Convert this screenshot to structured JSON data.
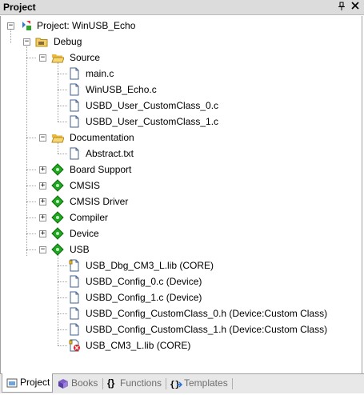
{
  "window": {
    "title": "Project"
  },
  "tree": {
    "root": "Project: WinUSB_Echo",
    "target": "Debug",
    "source": {
      "label": "Source",
      "files": [
        "main.c",
        "WinUSB_Echo.c",
        "USBD_User_CustomClass_0.c",
        "USBD_User_CustomClass_1.c"
      ]
    },
    "documentation": {
      "label": "Documentation",
      "files": [
        "Abstract.txt"
      ]
    },
    "components": [
      "Board Support",
      "CMSIS",
      "CMSIS Driver",
      "Compiler",
      "Device"
    ],
    "usb": {
      "label": "USB",
      "files": [
        "USB_Dbg_CM3_L.lib (CORE)",
        "USBD_Config_0.c (Device)",
        "USBD_Config_1.c (Device)",
        "USBD_Config_CustomClass_0.h (Device:Custom Class)",
        "USBD_Config_CustomClass_1.h (Device:Custom Class)",
        "USB_CM3_L.lib (CORE)"
      ]
    }
  },
  "tabs": [
    "Project",
    "Books",
    "Functions",
    "Templates"
  ],
  "colors": {
    "folder": "#f3cf63",
    "component": "#22a722",
    "tab_bg": "#e8e8e8"
  }
}
